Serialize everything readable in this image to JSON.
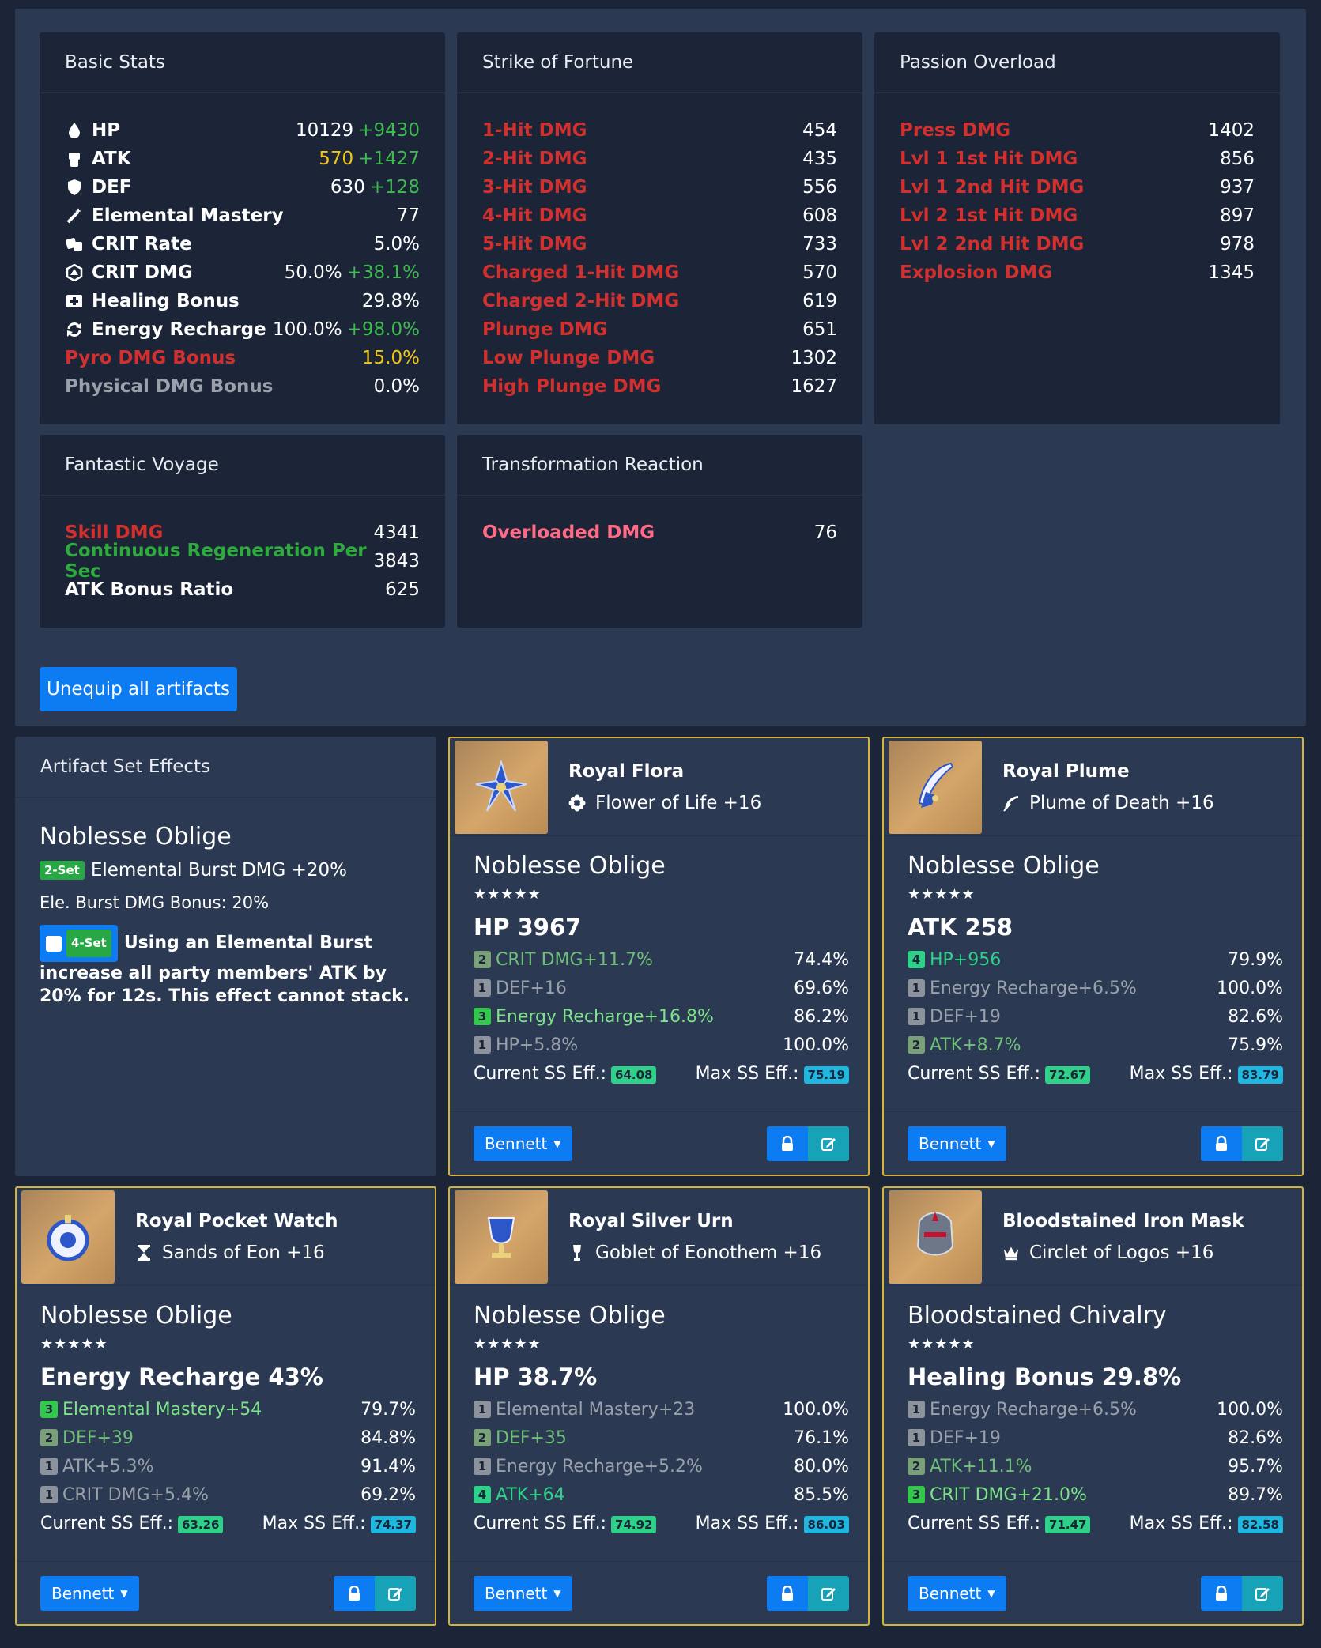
{
  "cards": {
    "basic": {
      "title": "Basic Stats",
      "rows": [
        {
          "label": "HP",
          "value": "10129",
          "bonus": "+9430"
        },
        {
          "label": "ATK",
          "value": "570",
          "bonus": "+1427"
        },
        {
          "label": "DEF",
          "value": "630",
          "bonus": "+128"
        },
        {
          "label": "Elemental Mastery",
          "value": "77"
        },
        {
          "label": "CRIT Rate",
          "value": "5.0%"
        },
        {
          "label": "CRIT DMG",
          "value": "50.0%",
          "bonus": "+38.1%"
        },
        {
          "label": "Healing Bonus",
          "value": "29.8%"
        },
        {
          "label": "Energy Recharge",
          "value": "100.0%",
          "bonus": "+98.0%"
        },
        {
          "label": "Pyro DMG Bonus",
          "value": "15.0%"
        },
        {
          "label": "Physical DMG Bonus",
          "value": "0.0%"
        }
      ]
    },
    "strike": {
      "title": "Strike of Fortune",
      "rows": [
        {
          "label": "1-Hit DMG",
          "value": "454"
        },
        {
          "label": "2-Hit DMG",
          "value": "435"
        },
        {
          "label": "3-Hit DMG",
          "value": "556"
        },
        {
          "label": "4-Hit DMG",
          "value": "608"
        },
        {
          "label": "5-Hit DMG",
          "value": "733"
        },
        {
          "label": "Charged 1-Hit DMG",
          "value": "570"
        },
        {
          "label": "Charged 2-Hit DMG",
          "value": "619"
        },
        {
          "label": "Plunge DMG",
          "value": "651"
        },
        {
          "label": "Low Plunge DMG",
          "value": "1302"
        },
        {
          "label": "High Plunge DMG",
          "value": "1627"
        }
      ]
    },
    "passion": {
      "title": "Passion Overload",
      "rows": [
        {
          "label": "Press DMG",
          "value": "1402"
        },
        {
          "label": "Lvl 1 1st Hit DMG",
          "value": "856"
        },
        {
          "label": "Lvl 1 2nd Hit DMG",
          "value": "937"
        },
        {
          "label": "Lvl 2 1st Hit DMG",
          "value": "897"
        },
        {
          "label": "Lvl 2 2nd Hit DMG",
          "value": "978"
        },
        {
          "label": "Explosion DMG",
          "value": "1345"
        }
      ]
    },
    "voyage": {
      "title": "Fantastic Voyage",
      "rows": [
        {
          "label": "Skill DMG",
          "value": "4341"
        },
        {
          "label": "Continuous Regeneration Per Sec",
          "value": "3843"
        },
        {
          "label": "ATK Bonus Ratio",
          "value": "625"
        }
      ]
    },
    "transform": {
      "title": "Transformation Reaction",
      "rows": [
        {
          "label": "Overloaded DMG",
          "value": "76"
        }
      ]
    }
  },
  "unequip_label": "Unequip all artifacts",
  "set_effects": {
    "title": "Artifact Set Effects",
    "set_name": "Noblesse Oblige",
    "two_badge": "2-Set",
    "two_text": "Elemental Burst DMG +20%",
    "two_detail": "Ele. Burst DMG Bonus: 20%",
    "four_badge": "4-Set",
    "four_text_a": "Using an Elemental Burst",
    "four_text_b": "increase all party members' ATK by 20% for 12s. This effect cannot stack."
  },
  "common": {
    "stars": "★★★★★",
    "cur_label": "Current SS Eff.:",
    "max_label": "Max SS Eff.:",
    "owner": "Bennett"
  },
  "artifacts": [
    {
      "name": "Royal Flora",
      "slot": "Flower of Life +16",
      "set": "Noblesse Oblige",
      "main": "HP 3967",
      "subs": [
        {
          "r": "2",
          "t": "CRIT DMG+11.7%",
          "p": "74.4%"
        },
        {
          "r": "1",
          "t": "DEF+16",
          "p": "69.6%"
        },
        {
          "r": "3",
          "t": "Energy Recharge+16.8%",
          "p": "86.2%"
        },
        {
          "r": "1",
          "t": "HP+5.8%",
          "p": "100.0%"
        }
      ],
      "cur": "64.08",
      "max": "75.19"
    },
    {
      "name": "Royal Plume",
      "slot": "Plume of Death +16",
      "set": "Noblesse Oblige",
      "main": "ATK 258",
      "subs": [
        {
          "r": "4",
          "t": "HP+956",
          "p": "79.9%"
        },
        {
          "r": "1",
          "t": "Energy Recharge+6.5%",
          "p": "100.0%"
        },
        {
          "r": "1",
          "t": "DEF+19",
          "p": "82.6%"
        },
        {
          "r": "2",
          "t": "ATK+8.7%",
          "p": "75.9%"
        }
      ],
      "cur": "72.67",
      "max": "83.79"
    },
    {
      "name": "Royal Pocket Watch",
      "slot": "Sands of Eon +16",
      "set": "Noblesse Oblige",
      "main": "Energy Recharge 43%",
      "subs": [
        {
          "r": "3",
          "t": "Elemental Mastery+54",
          "p": "79.7%"
        },
        {
          "r": "2",
          "t": "DEF+39",
          "p": "84.8%"
        },
        {
          "r": "1",
          "t": "ATK+5.3%",
          "p": "91.4%"
        },
        {
          "r": "1",
          "t": "CRIT DMG+5.4%",
          "p": "69.2%"
        }
      ],
      "cur": "63.26",
      "max": "74.37"
    },
    {
      "name": "Royal Silver Urn",
      "slot": "Goblet of Eonothem +16",
      "set": "Noblesse Oblige",
      "main": "HP 38.7%",
      "subs": [
        {
          "r": "1",
          "t": "Elemental Mastery+23",
          "p": "100.0%"
        },
        {
          "r": "2",
          "t": "DEF+35",
          "p": "76.1%"
        },
        {
          "r": "1",
          "t": "Energy Recharge+5.2%",
          "p": "80.0%"
        },
        {
          "r": "4",
          "t": "ATK+64",
          "p": "85.5%"
        }
      ],
      "cur": "74.92",
      "max": "86.03"
    },
    {
      "name": "Bloodstained Iron Mask",
      "slot": "Circlet of Logos +16",
      "set": "Bloodstained Chivalry",
      "main": "Healing Bonus 29.8%",
      "subs": [
        {
          "r": "1",
          "t": "Energy Recharge+6.5%",
          "p": "100.0%"
        },
        {
          "r": "1",
          "t": "DEF+19",
          "p": "82.6%"
        },
        {
          "r": "2",
          "t": "ATK+11.1%",
          "p": "95.7%"
        },
        {
          "r": "3",
          "t": "CRIT DMG+21.0%",
          "p": "89.7%"
        }
      ],
      "cur": "71.47",
      "max": "82.58"
    }
  ]
}
